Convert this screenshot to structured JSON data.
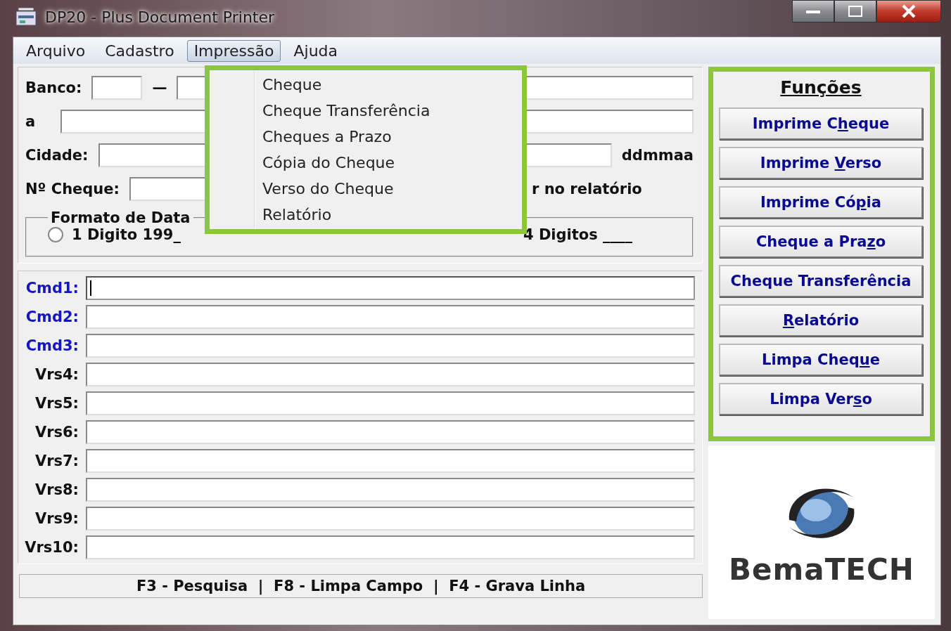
{
  "window": {
    "title": "DP20 - Plus Document Printer"
  },
  "menu": [
    {
      "label": "Arquivo",
      "selected": false
    },
    {
      "label": "Cadastro",
      "selected": false
    },
    {
      "label": "Impressão",
      "selected": true
    },
    {
      "label": "Ajuda",
      "selected": false
    }
  ],
  "dropdown": [
    "Cheque",
    "Cheque Transferência",
    "Cheques a Prazo",
    "Cópia do Cheque",
    "Verso do Cheque",
    "Relatório"
  ],
  "form": {
    "banco_label": "Banco:",
    "dash": "—",
    "a_label": "a",
    "cidade_label": "Cidade:",
    "date_hint": "ddmmaa",
    "cheque_label": "Nº Cheque:",
    "report_text": "r no relatório"
  },
  "date_format": {
    "legend": "Formato de Data",
    "options": [
      {
        "label": "1 Digito 199_",
        "selected": false
      },
      {
        "label": "4 Digitos ____"
      }
    ]
  },
  "commands": [
    {
      "label": "Cmd1:",
      "kind": "cmd",
      "focused": true
    },
    {
      "label": "Cmd2:",
      "kind": "cmd",
      "focused": false
    },
    {
      "label": "Cmd3:",
      "kind": "cmd",
      "focused": false
    },
    {
      "label": "Vrs4:",
      "kind": "vrs",
      "focused": false
    },
    {
      "label": "Vrs5:",
      "kind": "vrs",
      "focused": false
    },
    {
      "label": "Vrs6:",
      "kind": "vrs",
      "focused": false
    },
    {
      "label": "Vrs7:",
      "kind": "vrs",
      "focused": false
    },
    {
      "label": "Vrs8:",
      "kind": "vrs",
      "focused": false
    },
    {
      "label": "Vrs9:",
      "kind": "vrs",
      "focused": false
    },
    {
      "label": "Vrs10:",
      "kind": "vrs",
      "focused": false
    }
  ],
  "status_bar": "F3 - Pesquisa  |  F8 - Limpa Campo  |  F4 - Grava Linha",
  "functions": {
    "title": "Funções",
    "buttons": [
      {
        "before": "Imprime C",
        "key": "h",
        "after": "eque"
      },
      {
        "before": "Imprime ",
        "key": "V",
        "after": "erso"
      },
      {
        "before": "Imprime Có",
        "key": "p",
        "after": "ia"
      },
      {
        "before": "Cheque a Pra",
        "key": "z",
        "after": "o"
      },
      {
        "before": "Cheque Transferência"
      },
      {
        "key": "R",
        "after": "elatório"
      },
      {
        "before": "Limpa Cheq",
        "key": "u",
        "after": "e"
      },
      {
        "before": "Limpa Ver",
        "key": "s",
        "after": "o"
      }
    ]
  },
  "logo": {
    "text": "BemaTECH"
  }
}
